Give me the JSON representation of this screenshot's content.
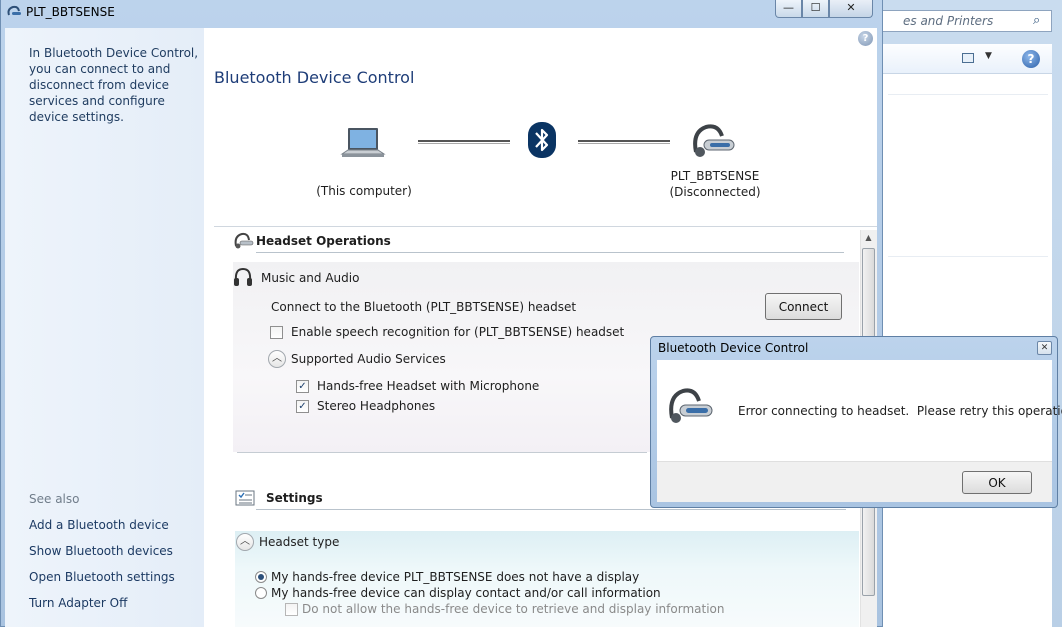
{
  "background_window": {
    "search_text": "es and Printers"
  },
  "window": {
    "title": "PLT_BBTSENSE",
    "minimize": "—",
    "maximize": "☐",
    "close": "✕",
    "help": "?"
  },
  "left_pane": {
    "description": "In Bluetooth Device Control, you can connect to and disconnect from device services and configure device settings.",
    "see_also": "See also",
    "links": [
      "Add a Bluetooth device",
      "Show Bluetooth devices",
      "Open Bluetooth settings",
      "Turn Adapter Off"
    ]
  },
  "main": {
    "heading": "Bluetooth Device Control",
    "computer_label": "(This computer)",
    "device_name": "PLT_BBTSENSE",
    "device_status": "(Disconnected)"
  },
  "operations": {
    "title": "Headset Operations",
    "music_title": "Music and Audio",
    "connect_label": "Connect to the Bluetooth (PLT_BBTSENSE) headset",
    "connect_button": "Connect",
    "speech_label": "Enable speech recognition for (PLT_BBTSENSE) headset",
    "speech_checked": false,
    "supported_label": "Supported Audio Services",
    "services": [
      {
        "label": "Hands-free Headset with Microphone",
        "checked": true
      },
      {
        "label": "Stereo Headphones",
        "checked": true
      }
    ]
  },
  "settings": {
    "title": "Settings",
    "headset_type": "Headset type",
    "radio1": "My hands-free device PLT_BBTSENSE does not have a display",
    "radio1_selected": true,
    "radio2": "My hands-free device can display contact and/or call information",
    "radio2_selected": false,
    "check3": "Do not allow the hands-free device to retrieve and display information",
    "check3_checked": false
  },
  "dialog": {
    "title": "Bluetooth Device Control",
    "message": "Error connecting to headset.  Please retry this operation.",
    "ok": "OK",
    "close": "✕"
  },
  "colors": {
    "heading": "#1e3d78",
    "link": "#1c3a63",
    "frame": "#bcd3ec"
  }
}
